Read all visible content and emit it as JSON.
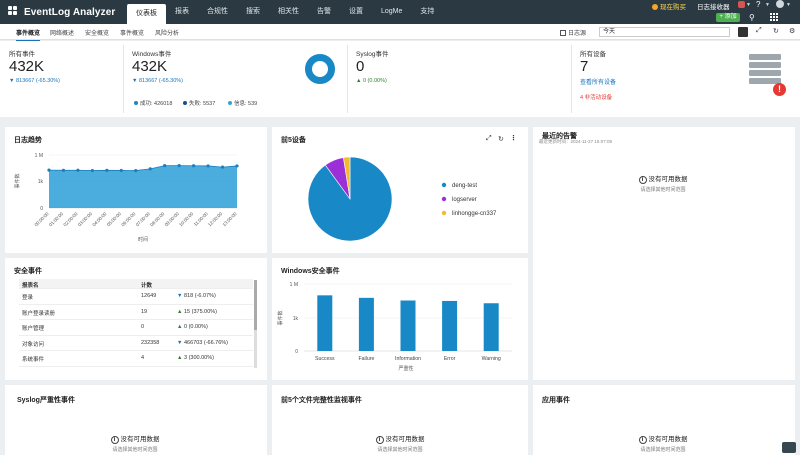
{
  "app": {
    "title": "EventLog Analyzer"
  },
  "nav": [
    "仪表板",
    "报表",
    "合规性",
    "搜索",
    "相关性",
    "告警",
    "设置",
    "LogMe",
    "支持"
  ],
  "topbar": {
    "buy_now": "现在购买",
    "log_collector": "日志接收器",
    "help": "?",
    "add_button": "+ 添加"
  },
  "subtabs": [
    "事件概览",
    "网络概述",
    "安全概览",
    "事件概览",
    "风险分析"
  ],
  "log_source_label": "日志源",
  "date_range": "今天",
  "stats": {
    "all_events": {
      "label": "所有事件",
      "value": "432K",
      "delta": "▼ 813667 (-65.30%)"
    },
    "windows_events": {
      "label": "Windows事件",
      "value": "432K",
      "delta": "▼ 813667 (-65.30%)",
      "legend": [
        {
          "label": "成功: 426018",
          "color": "#1888c7"
        },
        {
          "label": "失败: 5537",
          "color": "#1a4f8a"
        },
        {
          "label": "信息: 539",
          "color": "#3aa0d8"
        }
      ]
    },
    "syslog_events": {
      "label": "Syslog事件",
      "value": "0",
      "delta": "▲ 0 (0.00%)"
    },
    "all_devices": {
      "label": "所有设备",
      "value": "7",
      "link": "查看所有设备",
      "inactive": "4 非活动设备"
    }
  },
  "log_trend": {
    "title": "日志趋势",
    "ylabel": "事件数",
    "xlabel": "时间",
    "yticks": [
      "1 M",
      "1k",
      "0"
    ],
    "chart_data": {
      "type": "area",
      "x": [
        "00:00:00",
        "01:00:00",
        "02:00:00",
        "03:00:00",
        "04:00:00",
        "05:00:00",
        "06:00:00",
        "07:00:00",
        "08:00:00",
        "09:00:00",
        "10:00:00",
        "11:00:00",
        "12:00:00",
        "13:00:00"
      ],
      "values": [
        18000,
        17000,
        17500,
        16000,
        17000,
        16500,
        16000,
        25000,
        60000,
        60000,
        58000,
        55000,
        40000,
        55000
      ],
      "color": "#2c9fd8"
    }
  },
  "top5_devices": {
    "title": "前5设备",
    "chart_data": {
      "type": "pie",
      "slices": [
        {
          "name": "deng-test",
          "value": 90,
          "color": "#1888c7"
        },
        {
          "name": "logserver",
          "value": 7.5,
          "color": "#9b30d9"
        },
        {
          "name": "linhongge-cn337",
          "value": 2.5,
          "color": "#f5b82e"
        }
      ]
    }
  },
  "recent_alerts": {
    "title": "最近的告警",
    "subtitle": "最近更新时间：2024-11-27 15:07:09",
    "empty": "没有可用数据",
    "empty_hint": "请选择其他时间范围"
  },
  "security_events": {
    "title": "安全事件",
    "columns": [
      "报表名",
      "计数",
      ""
    ],
    "rows": [
      {
        "name": "登录",
        "count": "12649",
        "change": "818 (-6.07%)",
        "dir": "down"
      },
      {
        "name": "账户登录读册",
        "count": "19",
        "change": "15 (375.00%)",
        "dir": "up"
      },
      {
        "name": "账户管理",
        "count": "0",
        "change": "0 (0.00%)",
        "dir": "up"
      },
      {
        "name": "对象访问",
        "count": "232358",
        "change": "466703 (-66.76%)",
        "dir": "down"
      },
      {
        "name": "系统事件",
        "count": "4",
        "change": "3 (300.00%)",
        "dir": "up"
      }
    ]
  },
  "windows_security": {
    "title": "Windows安全事件",
    "ylabel": "事件数",
    "xlabel": "严重性",
    "yticks": [
      "1 M",
      "1k",
      "0"
    ],
    "chart_data": {
      "type": "bar",
      "categories": [
        "Success",
        "Failure",
        "Information",
        "Error",
        "Warning"
      ],
      "values": [
        100000,
        60000,
        35000,
        32000,
        20000
      ],
      "color": "#1888c7"
    }
  },
  "bottom_panels": [
    {
      "title": "Syslog严重性事件",
      "empty": "没有可用数据",
      "hint": "请选择其他时间范围"
    },
    {
      "title": "前5个文件完整性监视事件",
      "empty": "没有可用数据",
      "hint": "请选择其他时间范围"
    },
    {
      "title": "应用事件",
      "empty": "没有可用数据",
      "hint": "请选择其他时间范围"
    }
  ]
}
